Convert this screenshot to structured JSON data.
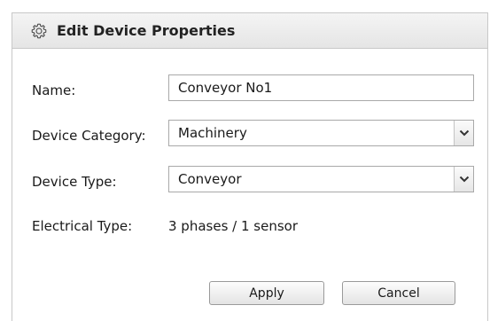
{
  "dialog": {
    "title": "Edit Device Properties",
    "title_icon": "gear-icon"
  },
  "form": {
    "name_label": "Name:",
    "name_value": "Conveyor No1",
    "category_label": "Device Category:",
    "category_value": "Machinery",
    "type_label": "Device Type:",
    "type_value": "Conveyor",
    "electrical_label": "Electrical Type:",
    "electrical_value": "3 phases / 1 sensor"
  },
  "buttons": {
    "apply_label": "Apply",
    "cancel_label": "Cancel"
  },
  "colors": {
    "title_bar_top": "#f4f4f4",
    "title_bar_bottom": "#e5e5e5",
    "border": "#c8c8c8"
  }
}
